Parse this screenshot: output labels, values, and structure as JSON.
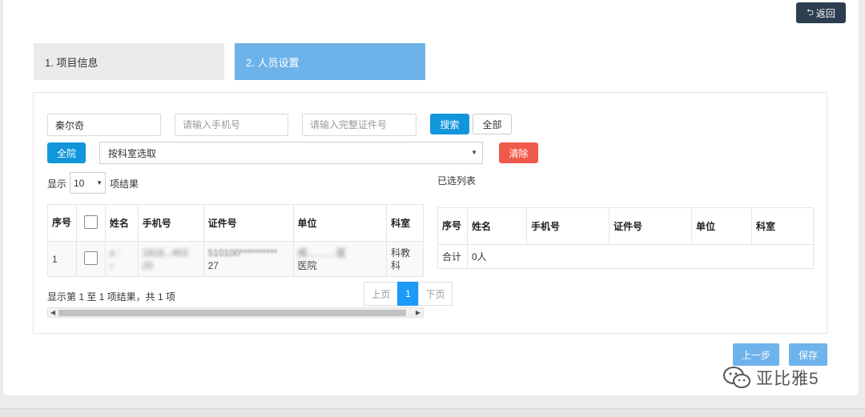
{
  "header": {
    "back_label": "返回",
    "back_icon": "return-icon"
  },
  "steps": [
    {
      "label": "1. 项目信息",
      "active": false
    },
    {
      "label": "2. 人员设置",
      "active": true
    }
  ],
  "colors": {
    "active_step": "#6db3ea",
    "primary": "#1296db",
    "danger": "#f05a4a",
    "dark": "#2c3e50"
  },
  "search": {
    "name_value": "秦尔奇",
    "phone_placeholder": "请输入手机号",
    "id_placeholder": "请输入完整证件号",
    "search_label": "搜索",
    "all_label": "全部",
    "whole_hospital_label": "全院",
    "dept_select": "按科室选取",
    "clear_label": "清除"
  },
  "left_table": {
    "show_label": "显示",
    "page_size": "10",
    "result_label": "项结果",
    "headers": {
      "seq": "序号",
      "name": "姓名",
      "phone": "手机号",
      "id": "证件号",
      "unit": "单位",
      "dept": "科室"
    },
    "rows": [
      {
        "seq": "1",
        "name_l1": "s    :",
        "name_l2": "  ‹",
        "phone_l1": "1818...453",
        "phone_l2": "20",
        "id_l1": "510100**********",
        "id_l2": "27",
        "unit_l1": "成...........医",
        "unit_l2": "医院",
        "dept": "科教科"
      }
    ],
    "summary": "显示第 1 至 1 项结果，共 1 项",
    "pager": {
      "prev": "上页",
      "current": "1",
      "next": "下页"
    }
  },
  "right_table": {
    "title": "已选列表",
    "headers": {
      "seq": "序号",
      "name": "姓名",
      "phone": "手机号",
      "id": "证件号",
      "unit": "单位",
      "dept": "科室"
    },
    "total_label": "合计",
    "total_value": "0人"
  },
  "footer": {
    "prev_label": "上一步",
    "save_label": "保存"
  },
  "watermark": {
    "text": "亚比雅5",
    "icon": "wechat-icon"
  }
}
